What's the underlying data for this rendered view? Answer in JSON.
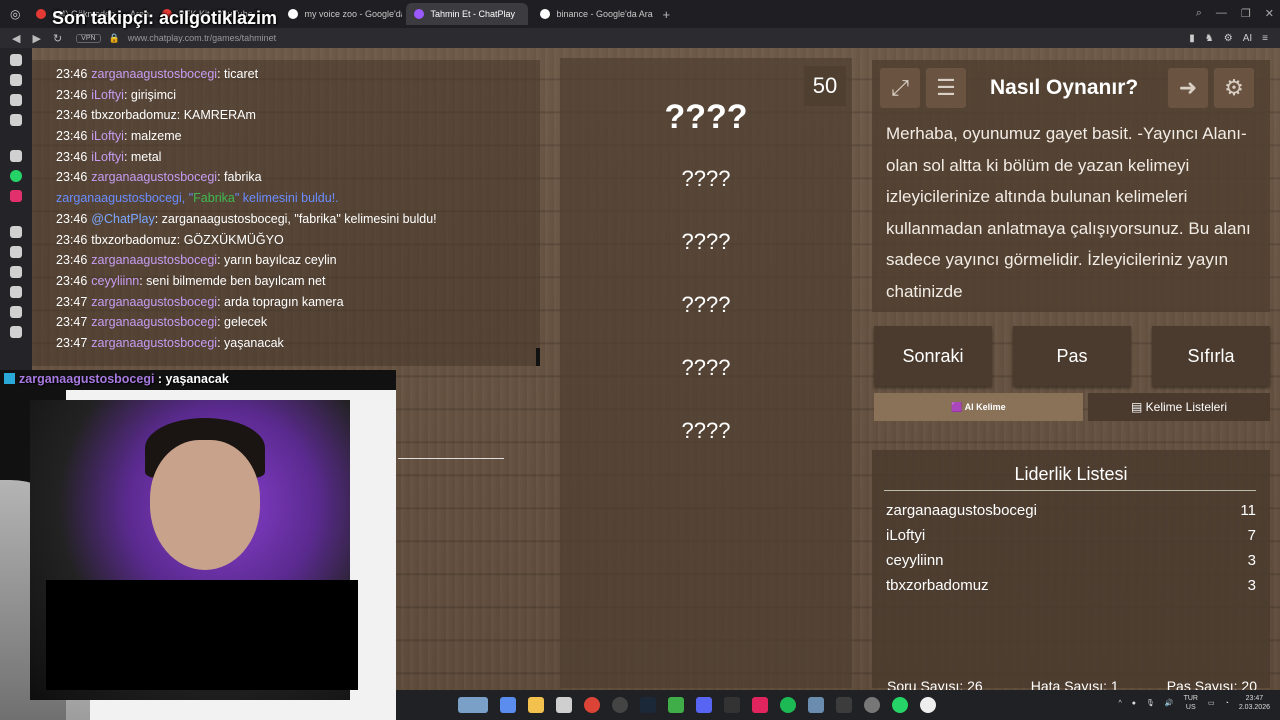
{
  "overlay": {
    "follower_text": "Son takipçi: acilgotiklazim"
  },
  "browser": {
    "tabs": [
      {
        "label": "(44) Gökmeden... - Arena",
        "color": "#e53935"
      },
      {
        "label": "PEK Kit - YouTube",
        "color": "#e53935"
      },
      {
        "label": "my voice zoo - Google'da A",
        "color": "#ffffff"
      },
      {
        "label": "Tahmin Et - ChatPlay",
        "color": "#9b59ff",
        "active": true
      },
      {
        "label": "binance - Google'da Ara",
        "color": "#ffffff"
      }
    ],
    "new_tab": "+",
    "vpn": "VPN",
    "url": "www.chatplay.com.tr/games/tahminet",
    "ai_label": "AI"
  },
  "chat": {
    "messages": [
      {
        "time": "23:46",
        "user": "zarganaagustosbocegi",
        "color": "purple",
        "text": ": ticaret"
      },
      {
        "time": "23:46",
        "user": "iLoftyi",
        "color": "purple",
        "text": ": girişimci"
      },
      {
        "time": "23:46",
        "user": "tbxzorbadomuz",
        "color": "white",
        "text": ": KAMRERAm"
      },
      {
        "time": "23:46",
        "user": "iLoftyi",
        "color": "purple",
        "text": ": malzeme"
      },
      {
        "time": "23:46",
        "user": "iLoftyi",
        "color": "purple",
        "text": ": metal"
      },
      {
        "time": "23:46",
        "user": "zarganaagustosbocegi",
        "color": "purple",
        "text": ": fabrika"
      },
      {
        "time": "23:46",
        "user": "@ChatPlay",
        "color": "blue",
        "text": ": zarganaagustosbocegi, \"fabrika\" kelimesini buldu!"
      },
      {
        "time": "23:46",
        "user": "tbxzorbadomuz",
        "color": "white",
        "text": ": GÖZXÜKMÜĞYO"
      },
      {
        "time": "23:46",
        "user": "zarganaagustosbocegi",
        "color": "purple",
        "text": ": yarın bayılcaz ceylin"
      },
      {
        "time": "23:46",
        "user": "ceyyliinn",
        "color": "purple",
        "text": ": seni bilmemde ben bayılcam net"
      },
      {
        "time": "23:47",
        "user": "zarganaagustosbocegi",
        "color": "purple",
        "text": ": arda topragın kamera"
      },
      {
        "time": "23:47",
        "user": "zarganaagustosbocegi",
        "color": "purple",
        "text": ": gelecek"
      },
      {
        "time": "23:47",
        "user": "zarganaagustosbocegi",
        "color": "purple",
        "text": ": yaşanacak"
      }
    ],
    "system": {
      "pre": "zarganaagustosbocegi, \"",
      "word": "Fabrika",
      "post": "\" kelimesini buldu!."
    },
    "popup": {
      "user": "zarganaagustosbocegi",
      "text": " : yaşanacak"
    }
  },
  "game": {
    "counter": "50",
    "words": [
      "????",
      "????",
      "????",
      "????",
      "????",
      "????"
    ]
  },
  "howto": {
    "title": "Nasıl Oynanır?",
    "text": "Merhaba, oyunumuz gayet basit. -Yayıncı Alanı- olan sol altta ki bölüm de yazan kelimeyi izleyicilerinize altında bulunan kelimeleri kullanmadan anlatmaya çalışıyorsunuz. Bu alanı sadece yayıncı görmelidir. İzleyicileriniz yayın chatinizde"
  },
  "buttons": {
    "next": "Sonraki",
    "pass": "Pas",
    "reset": "Sıfırla"
  },
  "subtabs": {
    "ai": "🟪 AI Kelime",
    "lists": "Kelime Listeleri"
  },
  "leaderboard": {
    "title": "Liderlik Listesi",
    "rows": [
      {
        "name": "zarganaagustosbocegi",
        "score": "11"
      },
      {
        "name": "iLoftyi",
        "score": "7"
      },
      {
        "name": "ceyyliinn",
        "score": "3"
      },
      {
        "name": "tbxzorbadomuz",
        "score": "3"
      }
    ]
  },
  "stats": {
    "questions": "Soru Sayısı: 26",
    "errors": "Hata Sayısı: 1",
    "passes": "Pas Sayısı: 20"
  },
  "taskbar": {
    "lang_top": "TUR",
    "lang_bottom": "US",
    "time": "23:47",
    "date": "2.03.2026"
  }
}
